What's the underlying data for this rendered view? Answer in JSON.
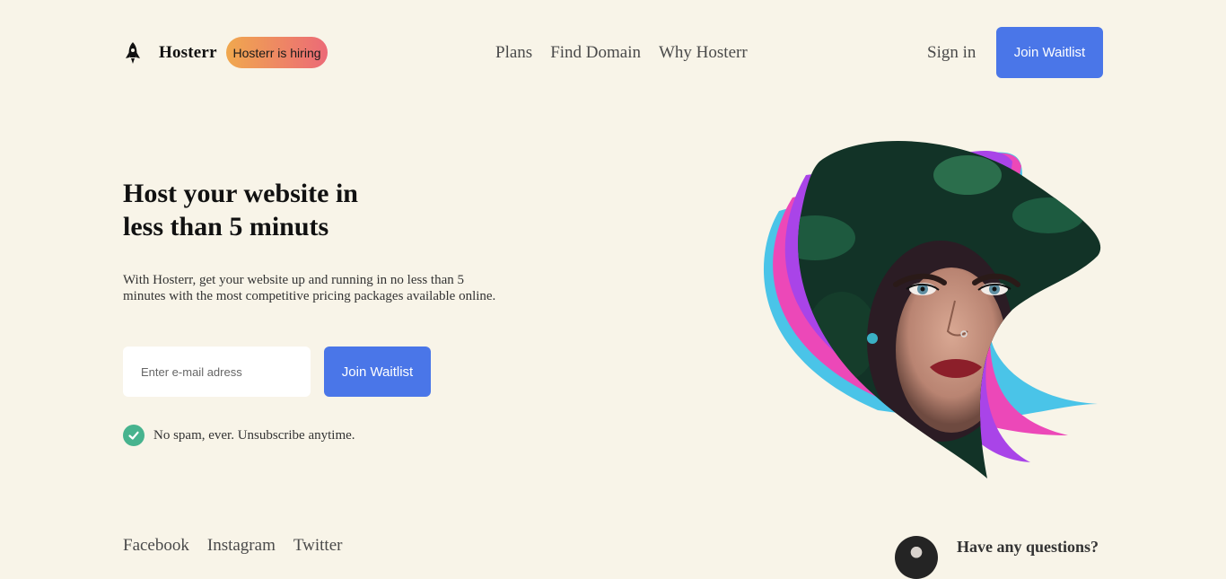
{
  "brand": {
    "name": "Hosterr",
    "logo_icon": "rocket-icon"
  },
  "badge": {
    "text": "Hosterr is hiring"
  },
  "nav": {
    "items": [
      {
        "label": "Plans"
      },
      {
        "label": "Find Domain"
      },
      {
        "label": "Why Hosterr"
      }
    ]
  },
  "header": {
    "signin_label": "Sign in",
    "cta_label": "Join Waitlist"
  },
  "hero": {
    "title_line1": "Host your website in",
    "title_line2": "less than 5 minuts",
    "subtitle": "With Hosterr, get your website up and running in no less than 5 minutes with the most competitive pricing packages available online.",
    "email_placeholder": "Enter e-mail adress",
    "cta_label": "Join Waitlist",
    "note_text": "No spam, ever. Unsubscribe anytime.",
    "note_icon": "check-icon"
  },
  "footer": {
    "social": [
      {
        "label": "Facebook"
      },
      {
        "label": "Instagram"
      },
      {
        "label": "Twitter"
      }
    ],
    "questions_text": "Have any questions?"
  },
  "colors": {
    "background": "#f8f4e8",
    "accent": "#4a76e8",
    "check": "#47b38e",
    "badge_gradient_start": "#f0a84e",
    "badge_gradient_end": "#ec6a77",
    "ribbon_blue": "#4ac4e8",
    "ribbon_pink": "#ec48b8",
    "ribbon_purple": "#a944e8"
  }
}
